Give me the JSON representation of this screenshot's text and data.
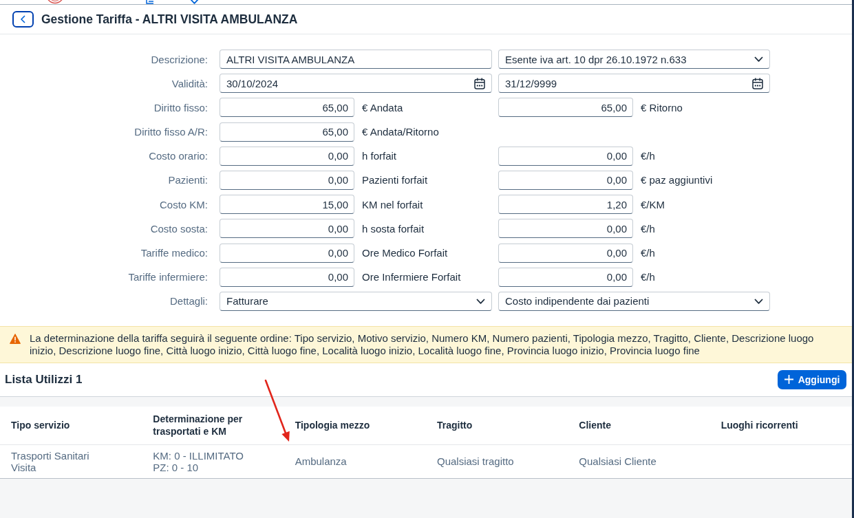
{
  "header": {
    "title": "Gestione Tariffa - ALTRI VISITA AMBULANZA"
  },
  "form": {
    "rows": [
      {
        "label": "Descrizione:",
        "fields": [
          {
            "kind": "text",
            "value": "ALTRI VISITA AMBULANZA"
          },
          {
            "kind": "select",
            "value": "Esente iva art. 10 dpr 26.10.1972 n.633"
          }
        ]
      },
      {
        "label": "Validità:",
        "fields": [
          {
            "kind": "date",
            "value": "30/10/2024"
          },
          {
            "kind": "date",
            "value": "31/12/9999"
          }
        ]
      },
      {
        "label": "Diritto fisso:",
        "fields": [
          {
            "kind": "number",
            "value": "65,00",
            "unit": "€ Andata"
          },
          {
            "kind": "number",
            "value": "65,00",
            "unit": "€ Ritorno"
          }
        ]
      },
      {
        "label": "Diritto fisso A/R:",
        "fields": [
          {
            "kind": "number",
            "value": "65,00",
            "unit": "€ Andata/Ritorno"
          }
        ]
      },
      {
        "label": "Costo orario:",
        "fields": [
          {
            "kind": "number",
            "value": "0,00",
            "unit": "h forfait"
          },
          {
            "kind": "number",
            "value": "0,00",
            "unit": "€/h"
          }
        ]
      },
      {
        "label": "Pazienti:",
        "fields": [
          {
            "kind": "number",
            "value": "0,00",
            "unit": "Pazienti forfait"
          },
          {
            "kind": "number",
            "value": "0,00",
            "unit": "€ paz aggiuntivi"
          }
        ]
      },
      {
        "label": "Costo KM:",
        "fields": [
          {
            "kind": "number",
            "value": "15,00",
            "unit": "KM nel forfait"
          },
          {
            "kind": "number",
            "value": "1,20",
            "unit": "€/KM"
          }
        ]
      },
      {
        "label": "Costo sosta:",
        "fields": [
          {
            "kind": "number",
            "value": "0,00",
            "unit": "h sosta forfait"
          },
          {
            "kind": "number",
            "value": "0,00",
            "unit": "€/h"
          }
        ]
      },
      {
        "label": "Tariffe medico:",
        "fields": [
          {
            "kind": "number",
            "value": "0,00",
            "unit": "Ore Medico Forfait"
          },
          {
            "kind": "number",
            "value": "0,00",
            "unit": "€/h"
          }
        ]
      },
      {
        "label": "Tariffe infermiere:",
        "fields": [
          {
            "kind": "number",
            "value": "0,00",
            "unit": "Ore Infermiere Forfait"
          },
          {
            "kind": "number",
            "value": "0,00",
            "unit": "€/h"
          }
        ]
      },
      {
        "label": "Dettagli:",
        "fields": [
          {
            "kind": "select",
            "value": "Fatturare"
          },
          {
            "kind": "select",
            "value": "Costo indipendente dai pazienti"
          }
        ]
      }
    ]
  },
  "warning": {
    "text": "La determinazione della tariffa seguirà il seguente ordine: Tipo servizio, Motivo servizio, Numero KM, Numero pazienti, Tipologia mezzo, Tragitto, Cliente, Descrizione luogo inizio, Descrizione luogo fine, Città luogo inizio, Città luogo fine, Località luogo inizio, Località luogo fine, Provincia luogo inizio, Provincia luogo fine"
  },
  "usage_list": {
    "title": "Lista Utilizzi 1",
    "add_button": "Aggiungi",
    "table": {
      "columns": [
        "Tipo servizio",
        "Determinazione per trasportati e KM",
        "Tipologia mezzo",
        "Tragitto",
        "Cliente",
        "Luoghi ricorrenti"
      ],
      "rows": [
        {
          "cells": [
            {
              "lines": [
                "Trasporti Sanitari",
                "Visita"
              ]
            },
            {
              "lines": [
                "KM: 0 - ILLIMITATO",
                "PZ: 0 - 10"
              ]
            },
            {
              "lines": [
                "Ambulanza"
              ]
            },
            {
              "lines": [
                "Qualsiasi tragitto"
              ]
            },
            {
              "lines": [
                "Qualsiasi Cliente"
              ]
            }
          ]
        }
      ]
    }
  }
}
